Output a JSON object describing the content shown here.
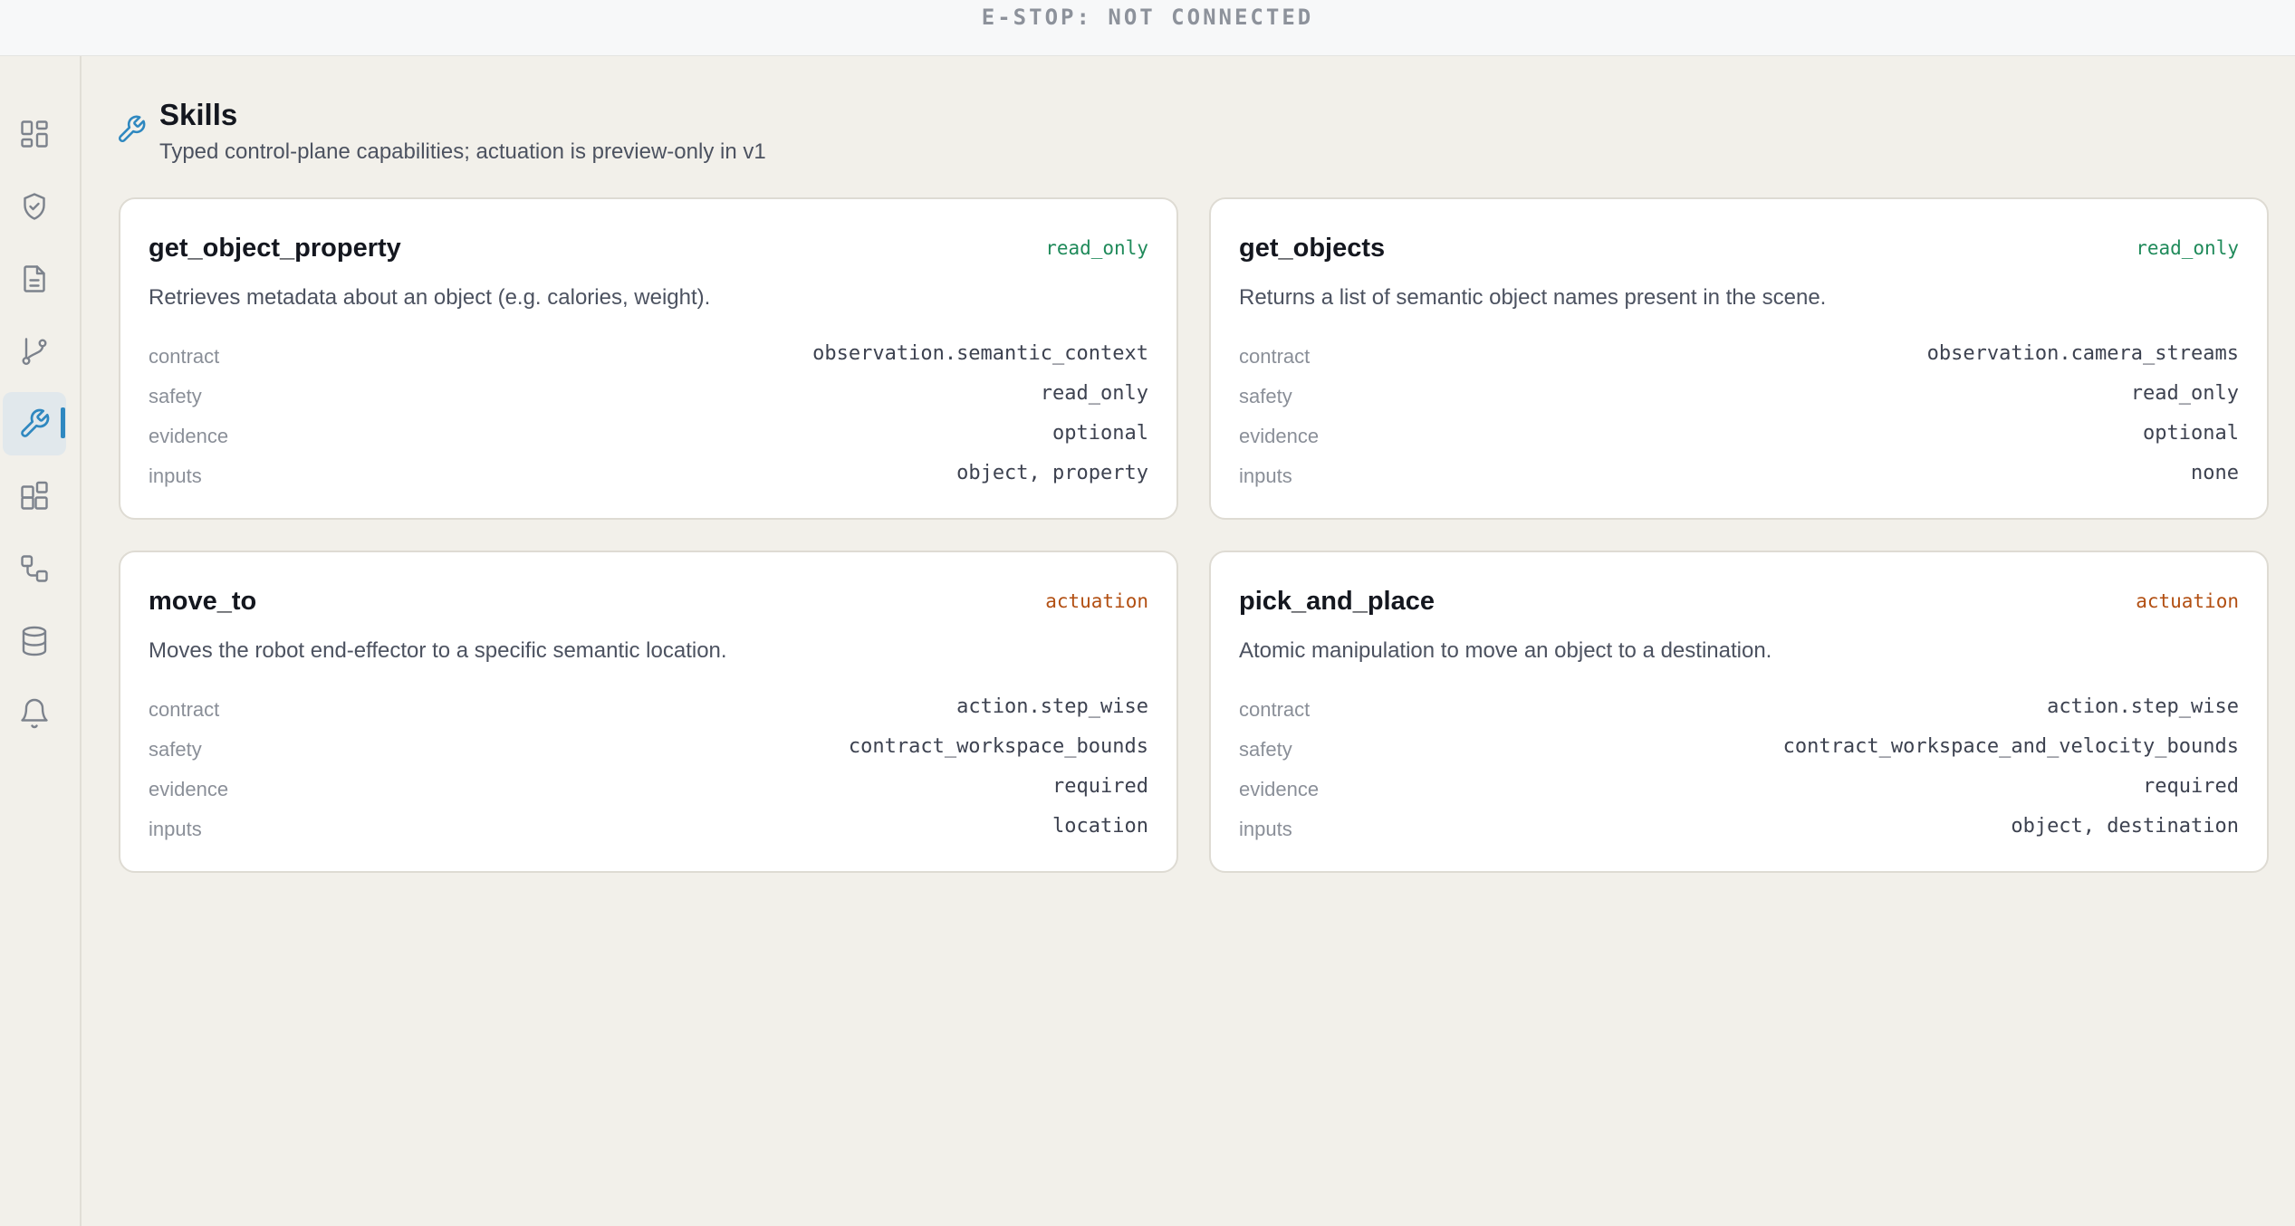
{
  "topbar": {
    "estop_status": "E-STOP: NOT CONNECTED"
  },
  "sidebar": {
    "items": [
      {
        "icon": "dashboard-icon",
        "active": false
      },
      {
        "icon": "shield-check-icon",
        "active": false
      },
      {
        "icon": "document-icon",
        "active": false
      },
      {
        "icon": "git-branch-icon",
        "active": false
      },
      {
        "icon": "wrench-icon",
        "active": true
      },
      {
        "icon": "blocks-icon",
        "active": false
      },
      {
        "icon": "workflow-icon",
        "active": false
      },
      {
        "icon": "database-icon",
        "active": false
      },
      {
        "icon": "bell-icon",
        "active": false
      }
    ]
  },
  "header": {
    "icon": "wrench-icon",
    "title": "Skills",
    "subtitle": "Typed control-plane capabilities; actuation is preview-only in v1"
  },
  "labels": {
    "contract": "contract",
    "safety": "safety",
    "evidence": "evidence",
    "inputs": "inputs"
  },
  "skills": [
    {
      "name": "get_object_property",
      "badge": "read_only",
      "description": "Retrieves metadata about an object (e.g. calories, weight).",
      "contract": "observation.semantic_context",
      "safety": "read_only",
      "evidence": "optional",
      "inputs": "object, property"
    },
    {
      "name": "get_objects",
      "badge": "read_only",
      "description": "Returns a list of semantic object names present in the scene.",
      "contract": "observation.camera_streams",
      "safety": "read_only",
      "evidence": "optional",
      "inputs": "none"
    },
    {
      "name": "move_to",
      "badge": "actuation",
      "description": "Moves the robot end-effector to a specific semantic location.",
      "contract": "action.step_wise",
      "safety": "contract_workspace_bounds",
      "evidence": "required",
      "inputs": "location"
    },
    {
      "name": "pick_and_place",
      "badge": "actuation",
      "description": "Atomic manipulation to move an object to a destination.",
      "contract": "action.step_wise",
      "safety": "contract_workspace_and_velocity_bounds",
      "evidence": "required",
      "inputs": "object, destination"
    }
  ],
  "colors": {
    "accent": "#2f88c0",
    "read_only": "#1f8a5a",
    "actuation": "#b24f12",
    "background": "#f2f0ea"
  }
}
